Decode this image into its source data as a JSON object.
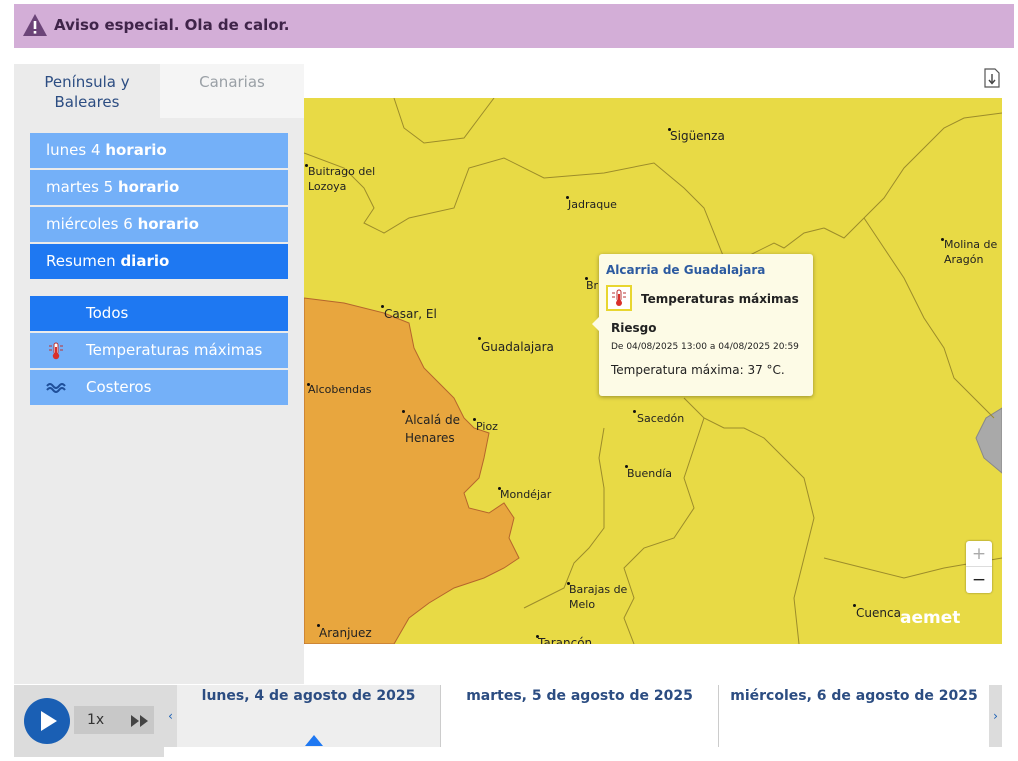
{
  "banner": {
    "text": "Aviso especial. Ola de calor.",
    "icon": "warning-triangle-icon",
    "color": "#d3aed7"
  },
  "tabs": [
    {
      "label": "Península y Baleares",
      "line1": "Península y",
      "line2": "Baleares",
      "active": true
    },
    {
      "label": "Canarias",
      "active": false
    }
  ],
  "periods": [
    {
      "day": "lunes 4",
      "mode": "horario"
    },
    {
      "day": "martes 5",
      "mode": "horario"
    },
    {
      "day": "miércoles 6",
      "mode": "horario"
    },
    {
      "day": "Resumen",
      "mode": "diario",
      "active": true
    }
  ],
  "filters": [
    {
      "label": "Todos",
      "icon": "",
      "active": true
    },
    {
      "label": "Temperaturas máximas",
      "icon": "thermometer-icon"
    },
    {
      "label": "Costeros",
      "icon": "waves-icon"
    }
  ],
  "map": {
    "colors": {
      "yellow": "#e8da45",
      "orange": "#e8a63e",
      "gray": "#a9a9a9"
    },
    "towns": {
      "siguenza": "Sigüenza",
      "buitrago_1": "Buitrago del",
      "buitrago_2": "Lozoya",
      "jadraque": "Jadraque",
      "molina_1": "Molina de",
      "molina_2": "Aragón",
      "casar": "Casar, El",
      "guadalajara": "Guadalajara",
      "alcobendas": "Alcobendas",
      "alcala_1": "Alcalá de",
      "alcala_2": "Henares",
      "pioz": "Pioz",
      "sacedon": "Sacedón",
      "buendia": "Buendía",
      "mondejar": "Mondéjar",
      "barajas_1": "Barajas de",
      "barajas_2": "Melo",
      "aranjuez": "Aranjuez",
      "tarancon": "Tarancón",
      "cuenca": "Cuenca",
      "bri": "Bri"
    },
    "popup": {
      "zone": "Alcarria de Guadalajara",
      "phenomenon": "Temperaturas máximas",
      "risk": "Riesgo",
      "dates": "De 04/08/2025 13:00 a 04/08/2025 20:59",
      "description": "Temperatura máxima: 37 °C."
    },
    "zoom_in": "+",
    "zoom_out": "−",
    "logo": "aemet"
  },
  "player": {
    "speed": "1x"
  },
  "timeline": {
    "prev": "‹",
    "next": "›",
    "days": [
      {
        "label": "lunes, 4 de agosto de 2025",
        "selected": true
      },
      {
        "label": "martes, 5 de agosto de 2025",
        "selected": false
      },
      {
        "label": "miércoles, 6 de agosto de 2025",
        "selected": false
      }
    ]
  }
}
